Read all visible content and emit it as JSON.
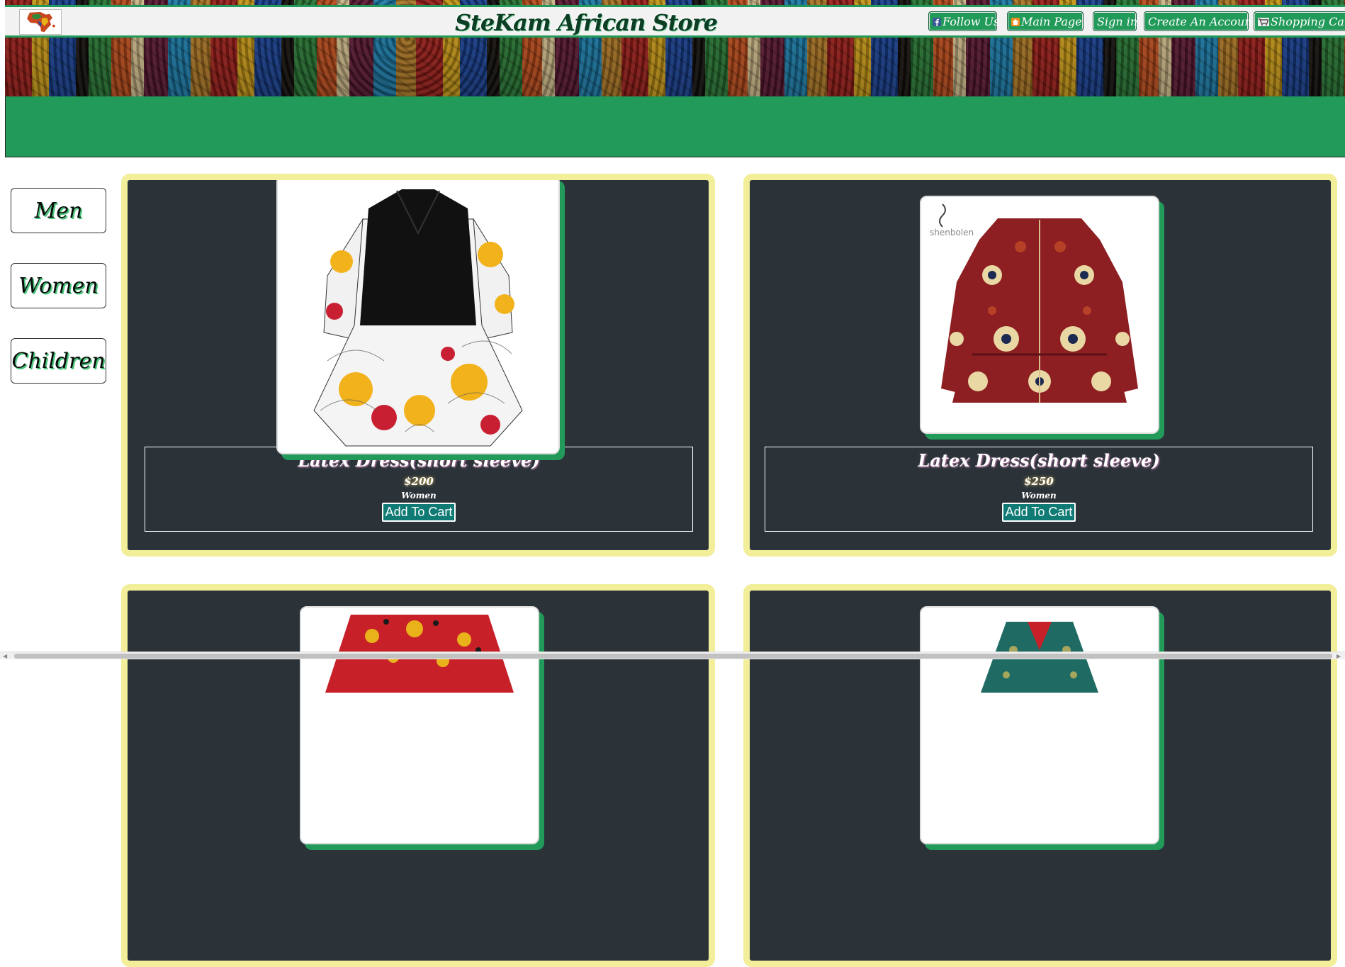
{
  "header": {
    "store_title": "SteKam African Store",
    "nav": [
      {
        "label": "Follow Us",
        "icon": "facebook-icon"
      },
      {
        "label": "Main Page",
        "icon": "home-icon"
      },
      {
        "label": "Sign in",
        "icon": ""
      },
      {
        "label": "Create An Account",
        "icon": ""
      },
      {
        "label": "Shopping Cart",
        "icon": "cart-icon"
      }
    ]
  },
  "sidebar": {
    "items": [
      {
        "label": "Men"
      },
      {
        "label": "Women"
      },
      {
        "label": "Children"
      }
    ]
  },
  "products": [
    {
      "name": "Latex Dress(short sleeve)",
      "price": "$200",
      "category": "Women",
      "button": "Add To Cart"
    },
    {
      "name": "Latex Dress(short sleeve)",
      "price": "$250",
      "category": "Women",
      "button": "Add To Cart"
    }
  ],
  "colors": {
    "brand_green": "#229a5a",
    "card_bg": "#2b3339",
    "card_border": "#f2ee99",
    "button_teal": "#0f7b74"
  }
}
